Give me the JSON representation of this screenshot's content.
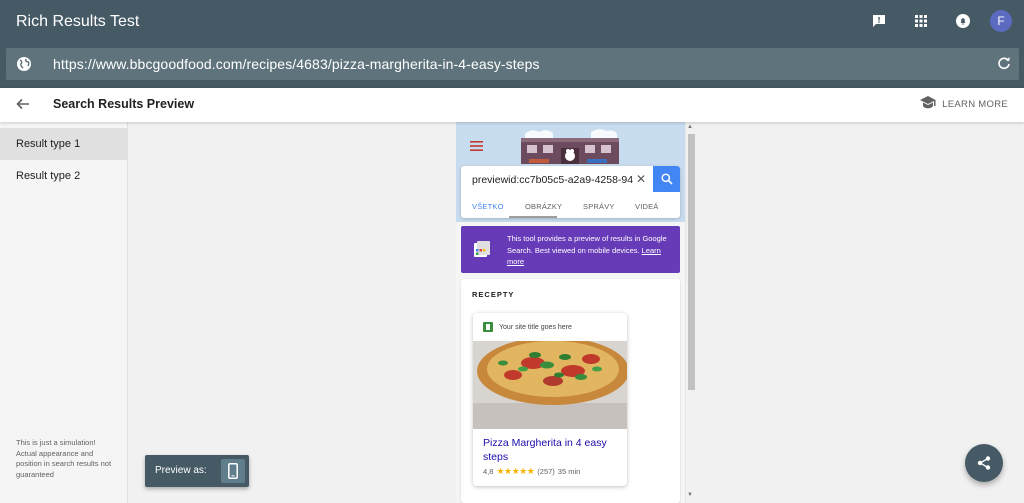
{
  "app": {
    "title": "Rich Results Test",
    "url": "https://www.bbcgoodfood.com/recipes/4683/pizza-margherita-in-4-easy-steps",
    "avatar_letter": "F",
    "avatar_color": "#5c6bc0",
    "accent_color": "#455a64"
  },
  "subheader": {
    "title": "Search Results Preview",
    "learn_more": "LEARN MORE"
  },
  "sidebar": {
    "items": [
      {
        "label": "Result type 1",
        "active": true
      },
      {
        "label": "Result type 2",
        "active": false
      }
    ],
    "disclaimer": "This is just a simulation! Actual appearance and position in search results not guaranteed"
  },
  "preview_as": {
    "label": "Preview as:",
    "icon": "smartphone-icon"
  },
  "preview": {
    "query": "previewid:cc7b05c5-a2a9-4258-94",
    "tabs": [
      {
        "label": "VŠETKO",
        "active": true
      },
      {
        "label": "OBRÁZKY",
        "active": false
      },
      {
        "label": "SPRÁVY",
        "active": false
      },
      {
        "label": "VIDEÁ",
        "active": false
      }
    ],
    "banner": {
      "text": "This tool provides a preview of results in Google Search. Best viewed on mobile devices.",
      "link": "Learn more",
      "color": "#673ab7"
    },
    "section_title": "RECEPTY",
    "recipe": {
      "site": "Your site title goes here",
      "name": "Pizza Margherita in 4 easy steps",
      "rating": "4,8",
      "stars": "★★★★★",
      "reviews": "(257)",
      "time": "35 min",
      "star_color": "#f4b400",
      "link_color": "#1a0dab"
    }
  }
}
